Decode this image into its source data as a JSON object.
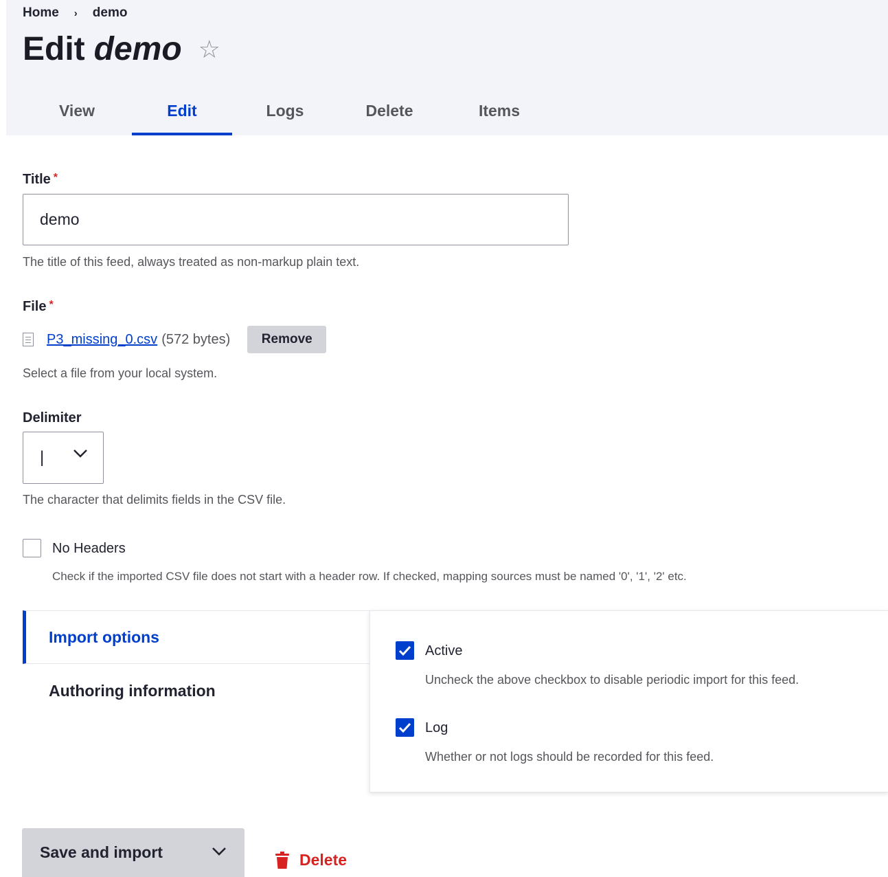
{
  "breadcrumb": {
    "home": "Home",
    "separator": "›",
    "current": "demo"
  },
  "page": {
    "title_prefix": "Edit",
    "title_name": "demo",
    "star": "☆"
  },
  "tabs": [
    {
      "label": "View"
    },
    {
      "label": "Edit",
      "active": true
    },
    {
      "label": "Logs"
    },
    {
      "label": "Delete"
    },
    {
      "label": "Items"
    }
  ],
  "form": {
    "title": {
      "label": "Title",
      "required_mark": "*",
      "value": "demo",
      "description": "The title of this feed, always treated as non-markup plain text."
    },
    "file": {
      "label": "File",
      "required_mark": "*",
      "filename": "P3_missing_0.csv",
      "size": "(572 bytes)",
      "remove_label": "Remove",
      "description": "Select a file from your local system."
    },
    "delimiter": {
      "label": "Delimiter",
      "value": "|",
      "description": "The character that delimits fields in the CSV file."
    },
    "no_headers": {
      "label": "No Headers",
      "checked": false,
      "description": "Check if the imported CSV file does not start with a header row. If checked, mapping sources must be named '0', '1', '2' etc."
    }
  },
  "vertical_tabs": {
    "items": [
      {
        "label": "Import options",
        "active": true
      },
      {
        "label": "Authoring information"
      }
    ],
    "panel": {
      "active": {
        "label": "Active",
        "checked": true,
        "description": "Uncheck the above checkbox to disable periodic import for this feed."
      },
      "log": {
        "label": "Log",
        "checked": true,
        "description": "Whether or not logs should be recorded for this feed."
      }
    }
  },
  "actions": {
    "primary_label": "Save and import",
    "delete_label": "Delete"
  },
  "colors": {
    "accent": "#003ecc",
    "danger": "#d72222",
    "header_bg": "#f3f4f9"
  }
}
